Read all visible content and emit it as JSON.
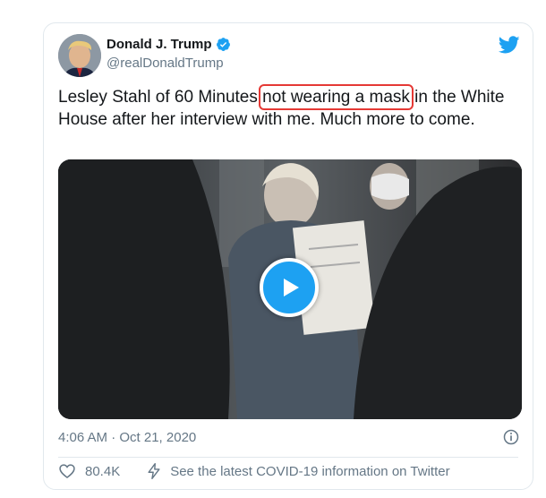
{
  "tweet": {
    "author_name": "Donald J. Trump",
    "handle": "@realDonaldTrump",
    "text_before": "Lesley Stahl of 60 Minutes ",
    "text_highlight": "not wearing a mask",
    "text_after": " in the White House after her interview with me. Much more to come.",
    "timestamp": "4:06 AM · Oct 21, 2020",
    "like_count": "80.4K",
    "covid_notice": "See the latest COVID-19 information on Twitter"
  },
  "colors": {
    "accent": "#1da1f2",
    "highlight_box": "#e53935",
    "secondary_text": "#657786"
  },
  "icons": {
    "verified": "verified-badge-icon",
    "logo": "twitter-bird-icon",
    "play": "play-icon",
    "info": "info-icon",
    "like": "heart-icon",
    "covid": "lightning-icon"
  }
}
